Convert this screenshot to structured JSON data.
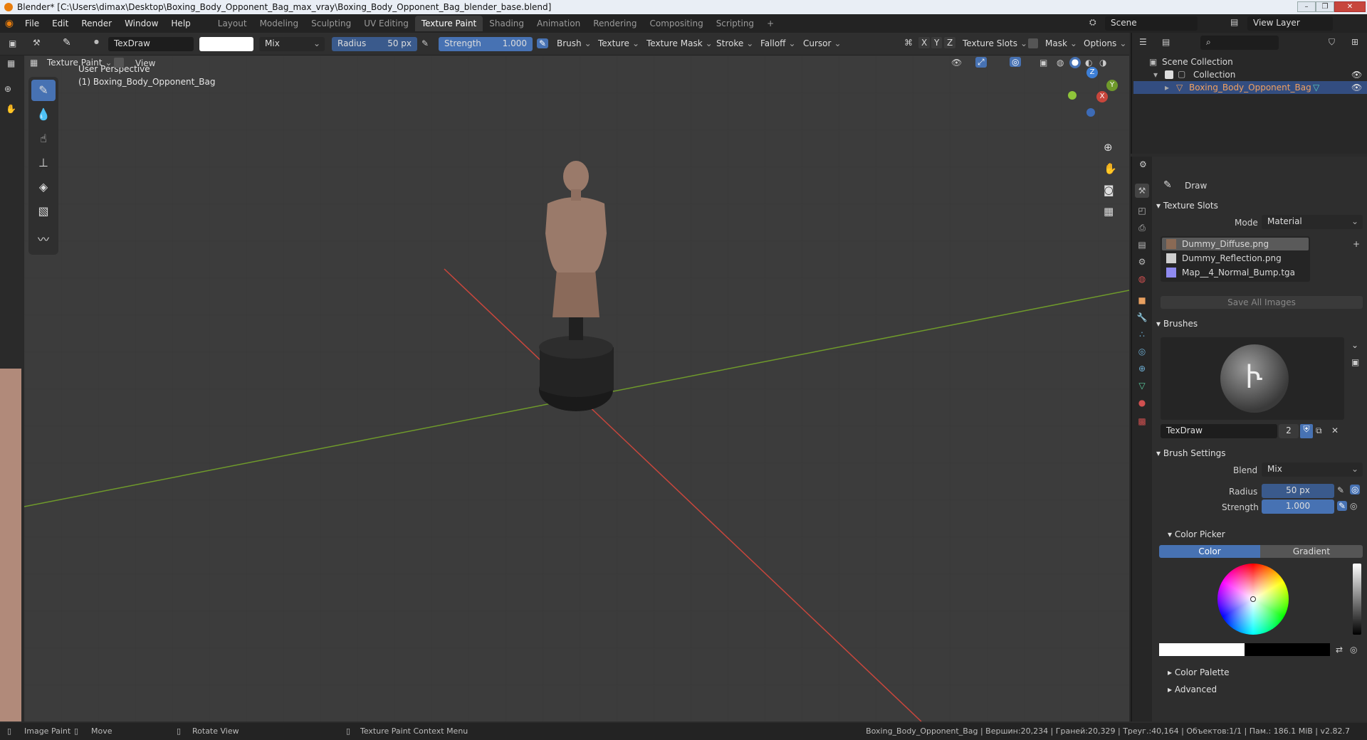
{
  "window": {
    "title": "Blender* [C:\\Users\\dimax\\Desktop\\Boxing_Body_Opponent_Bag_max_vray\\Boxing_Body_Opponent_Bag_blender_base.blend]"
  },
  "menu": [
    "File",
    "Edit",
    "Render",
    "Window",
    "Help"
  ],
  "workspaces": [
    {
      "label": "Layout",
      "active": false
    },
    {
      "label": "Modeling",
      "active": false
    },
    {
      "label": "Sculpting",
      "active": false
    },
    {
      "label": "UV Editing",
      "active": false
    },
    {
      "label": "Texture Paint",
      "active": true
    },
    {
      "label": "Shading",
      "active": false
    },
    {
      "label": "Animation",
      "active": false
    },
    {
      "label": "Rendering",
      "active": false
    },
    {
      "label": "Compositing",
      "active": false
    },
    {
      "label": "Scripting",
      "active": false
    }
  ],
  "add_workspace": "+",
  "scene": {
    "name": "Scene",
    "view_layer": "View Layer"
  },
  "header": {
    "brush_name": "TexDraw",
    "blend": "Mix",
    "radius_label": "Radius",
    "radius_value": "50 px",
    "strength_label": "Strength",
    "strength_value": "1.000",
    "menus": [
      "Brush",
      "Texture",
      "Texture Mask",
      "Stroke",
      "Falloff",
      "Cursor"
    ],
    "axes": [
      "X",
      "Y",
      "Z"
    ],
    "texture_slots": "Texture Slots",
    "mask": "Mask",
    "options": "Options",
    "mode": "Texture Paint",
    "view": "View"
  },
  "viewport": {
    "perspective": "User Perspective",
    "object": "(1) Boxing_Body_Opponent_Bag",
    "gizmo": {
      "x": "X",
      "y": "Y",
      "z": "Z"
    }
  },
  "outliner": {
    "scene_collection": "Scene Collection",
    "collection": "Collection",
    "object": "Boxing_Body_Opponent_Bag"
  },
  "properties": {
    "tool_name": "Draw",
    "texture_slots": {
      "title": "Texture Slots",
      "mode_label": "Mode",
      "mode_value": "Material",
      "items": [
        {
          "name": "Dummy_Diffuse.png",
          "color": "#8a6a55",
          "selected": true
        },
        {
          "name": "Dummy_Reflection.png",
          "color": "#cfcfcf",
          "selected": false
        },
        {
          "name": "Map__4_Normal_Bump.tga",
          "color": "#8f8af0",
          "selected": false
        }
      ],
      "save_all": "Save All Images"
    },
    "brushes": {
      "title": "Brushes",
      "brush_name": "TexDraw",
      "users": "2"
    },
    "brush_settings": {
      "title": "Brush Settings",
      "blend_label": "Blend",
      "blend_value": "Mix",
      "radius_label": "Radius",
      "radius_value": "50 px",
      "strength_label": "Strength",
      "strength_value": "1.000"
    },
    "color_picker": {
      "title": "Color Picker",
      "tab_color": "Color",
      "tab_gradient": "Gradient"
    },
    "color_palette": "Color Palette",
    "advanced": "Advanced"
  },
  "status": {
    "image_paint": "Image Paint",
    "move": "Move",
    "rotate_view": "Rotate View",
    "context_menu": "Texture Paint Context Menu",
    "stats": "Boxing_Body_Opponent_Bag | Вершин:20,234 | Граней:20,329 | Треуг.:40,164 | Объектов:1/1 | Пам.: 186.1 MiB | v2.82.7"
  },
  "colors": {
    "accent": "#4772b3",
    "bg": "#3c3c3c",
    "x_axis": "#c8463c",
    "y_axis": "#6f9a2b",
    "z_axis": "#3d7fd6"
  }
}
